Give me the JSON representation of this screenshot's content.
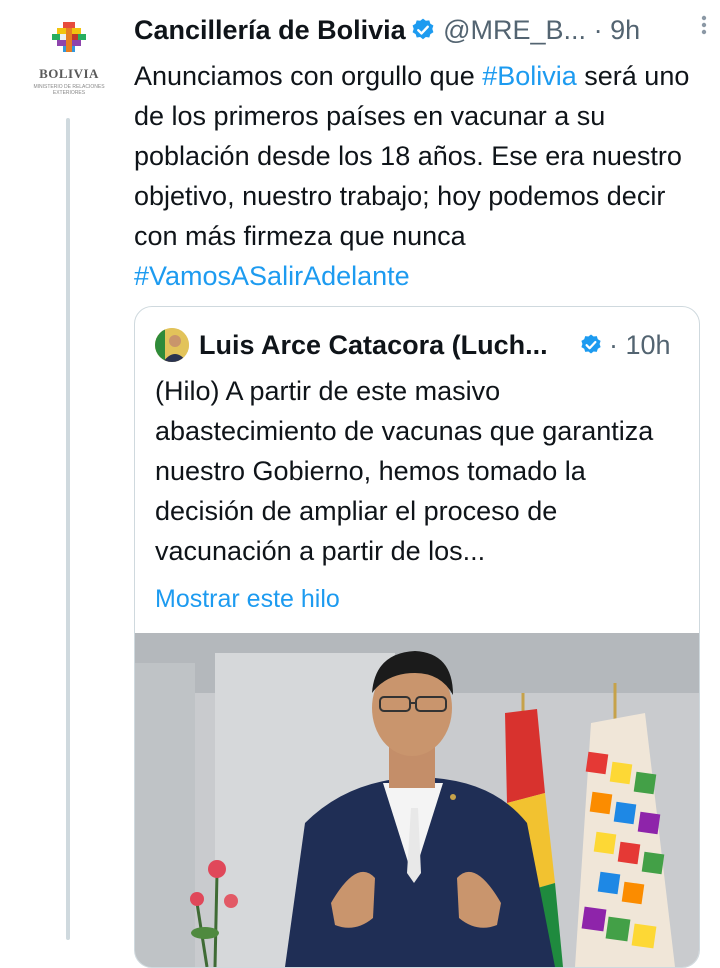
{
  "tweet": {
    "author_name": "Cancillería de Bolivia",
    "handle": "@MRE_B...",
    "dot": "·",
    "time": "9h",
    "avatar_label": "BOLIVIA",
    "avatar_sublabel": "MINISTERIO DE RELACIONES EXTERIORES",
    "text_part1": "Anunciamos con orgullo que ",
    "hashtag1": "#Bolivia",
    "text_part2": " será uno de los primeros países en vacunar a su población desde los 18 años. Ese era nuestro objetivo, nuestro trabajo; hoy podemos decir con más firmeza que nunca ",
    "hashtag2": "#VamosASalirAdelante"
  },
  "quoted": {
    "author_name": "Luis Arce Catacora (Luch...",
    "time": "· 10h",
    "text": "(Hilo) A partir de este masivo abastecimiento de vacunas que garantiza nuestro Gobierno, hemos tomado la decisión de ampliar el proceso de vacunación a partir de los...",
    "show_thread": "Mostrar este hilo"
  },
  "colors": {
    "accent": "#1d9bf0",
    "text": "#0f1419",
    "muted": "#536471",
    "border": "#cfd9de"
  },
  "icons": {
    "verified": "verified-badge-icon",
    "more": "more-options-icon"
  }
}
